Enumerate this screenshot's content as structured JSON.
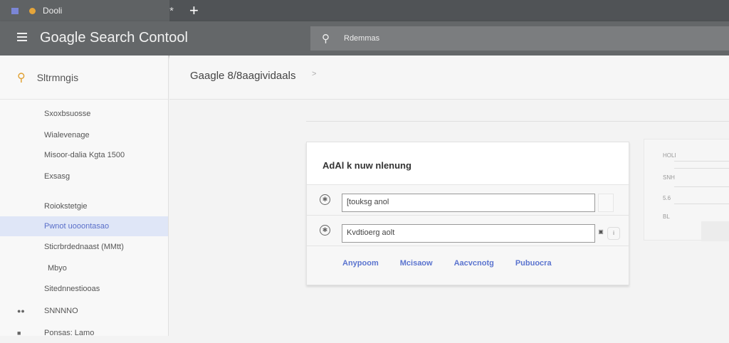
{
  "browser": {
    "tab_title": "Dooli",
    "close": "*",
    "new_tab": "+"
  },
  "header": {
    "brand": "Goagle Search Contool",
    "search_value": "Rdemmas"
  },
  "sidebar": {
    "title": "Sltrmngis",
    "items": [
      {
        "label": "Sxoxbsuosse"
      },
      {
        "label": "Wialevenage"
      },
      {
        "label": "Misoor-dalia Kgta 1500"
      },
      {
        "label": "Exsasg"
      },
      {
        "label": "Roiokstetgie"
      },
      {
        "label": "Pwnot uooontasao",
        "active": true
      },
      {
        "label": "Sticrbrdednaast (MMtt)"
      },
      {
        "label": "Mbyo"
      },
      {
        "label": "Sitednnestiooas"
      },
      {
        "label": "SNNNNO"
      },
      {
        "label": "Ponsas: Lamo"
      }
    ]
  },
  "page": {
    "title": "Gaagle 8/8aagividaals",
    "chevron": ">"
  },
  "card": {
    "title": "AdAl k nuw nlenung",
    "inputs": [
      {
        "value": "[touksg anol"
      },
      {
        "value": "Kvdtioerg aolt"
      }
    ],
    "links": [
      "Anypoom",
      "Mcisaow",
      "Aacvcnotg",
      "Pubuocra"
    ]
  },
  "panel": {
    "labels": [
      "HOLI",
      "SNH",
      "5.6",
      "BL"
    ]
  },
  "colors": {
    "accent": "#5b74cf",
    "active_bg": "#dfe6f7",
    "header": "#646769"
  }
}
